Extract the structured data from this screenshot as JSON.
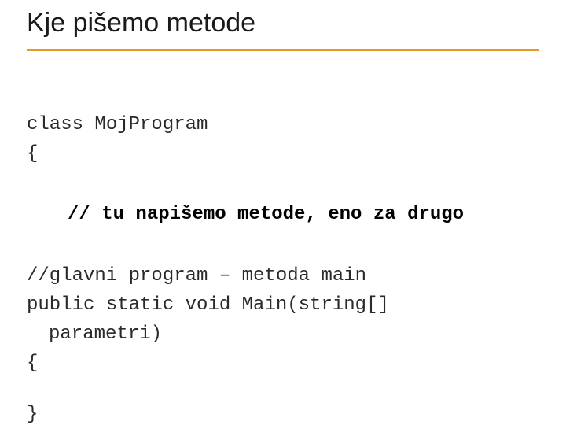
{
  "slide": {
    "title": "Kje pišemo metode",
    "code": {
      "line1": "class MojProgram",
      "line2": "{",
      "line3": "// tu napišemo metode, eno za drugo",
      "line4": "//glavni program – metoda main",
      "line5a": "public static void Main(string[]",
      "line5b": "parametri)",
      "line6": "{",
      "line7": "}"
    }
  }
}
